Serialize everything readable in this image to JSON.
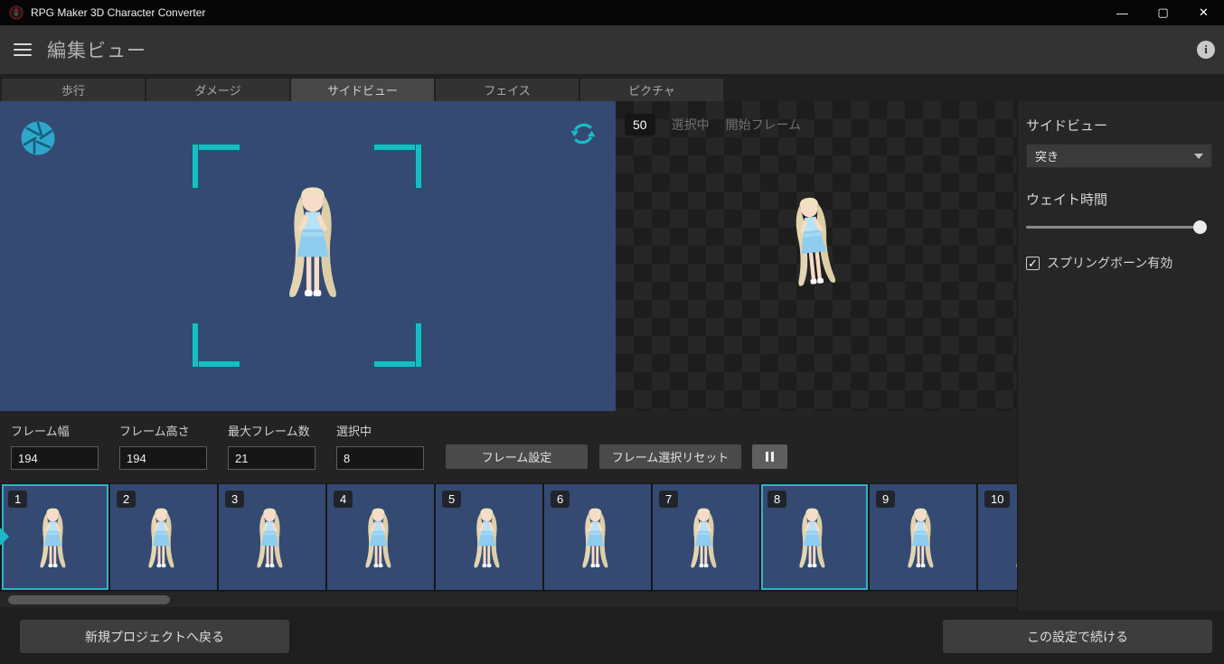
{
  "titlebar": {
    "title": "RPG Maker 3D Character Converter",
    "minimize": "—",
    "maximize": "▢",
    "close": "✕"
  },
  "header": {
    "title": "編集ビュー",
    "info": "i"
  },
  "tabs": [
    {
      "label": "歩行",
      "active": false
    },
    {
      "label": "ダメージ",
      "active": false
    },
    {
      "label": "サイドビュー",
      "active": true
    },
    {
      "label": "フェイス",
      "active": false
    },
    {
      "label": "ピクチャ",
      "active": false
    }
  ],
  "animation_panel": {
    "frame_counter": "50",
    "selected_label": "選択中",
    "start_frame_label": "開始フレーム"
  },
  "sidebar": {
    "title": "サイドビュー",
    "motion_value": "突き",
    "wait_time_label": "ウェイト時間",
    "springbone_label": "スプリングボーン有効",
    "springbone_checked": true,
    "check_glyph": "✓"
  },
  "frame_controls": {
    "width_label": "フレーム幅",
    "width_value": "194",
    "height_label": "フレーム高さ",
    "height_value": "194",
    "max_label": "最大フレーム数",
    "max_value": "21",
    "selected_label": "選択中",
    "selected_value": "8",
    "settings_button": "フレーム設定",
    "reset_button": "フレーム選択リセット"
  },
  "filmstrip": {
    "frames": [
      {
        "number": "1",
        "selected": true,
        "current": true
      },
      {
        "number": "2",
        "selected": false
      },
      {
        "number": "3",
        "selected": false
      },
      {
        "number": "4",
        "selected": false
      },
      {
        "number": "5",
        "selected": false
      },
      {
        "number": "6",
        "selected": false
      },
      {
        "number": "7",
        "selected": false
      },
      {
        "number": "8",
        "selected": true
      },
      {
        "number": "9",
        "selected": false
      },
      {
        "number": "10",
        "selected": false
      }
    ]
  },
  "footer": {
    "back_button": "新規プロジェクトへ戻る",
    "continue_button": "この設定で続ける"
  },
  "colors": {
    "accent_teal": "#1fb8c8",
    "preview_blue": "#344a73",
    "panel_dark": "#232323"
  }
}
